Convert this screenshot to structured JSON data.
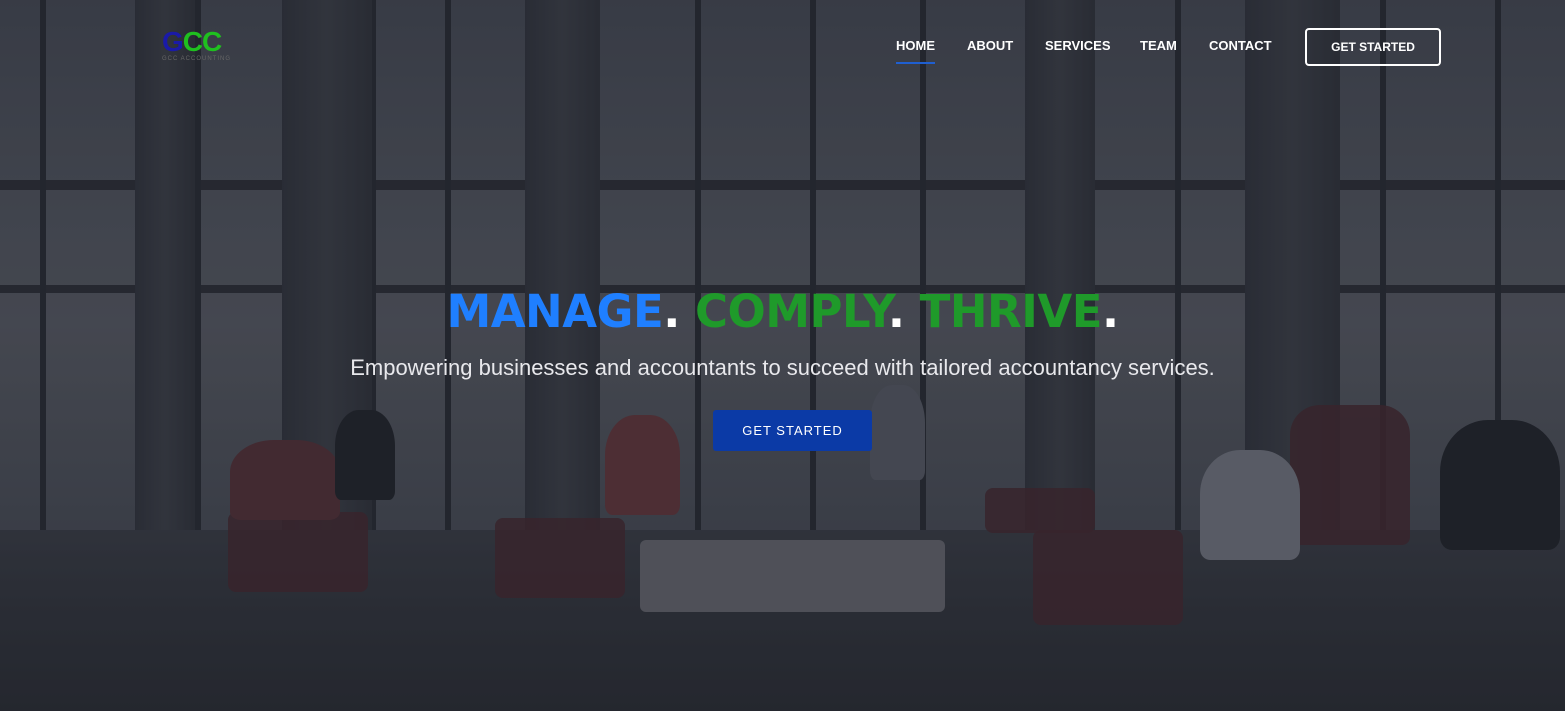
{
  "header": {
    "logo": {
      "mark_first": "G",
      "mark_rest": "CC",
      "tagline": "GCC ACCOUNTING"
    },
    "nav": [
      {
        "label": "HOME",
        "active": true
      },
      {
        "label": "ABOUT",
        "active": false
      },
      {
        "label": "SERVICES",
        "active": false
      },
      {
        "label": "TEAM",
        "active": false
      },
      {
        "label": "CONTACT",
        "active": false
      }
    ],
    "cta_label": "GET STARTED"
  },
  "hero": {
    "headline": {
      "word1": "MANAGE",
      "word2": "COMPLY",
      "word3": "THRIVE",
      "dot": "."
    },
    "subtitle": "Empowering businesses and accountants to succeed with tailored accountancy services.",
    "cta_label": "GET STARTED"
  },
  "colors": {
    "accent_blue": "#1f7fff",
    "accent_green": "#1f9a2a",
    "button_blue": "#0b3aa6",
    "nav_underline": "#1f5fd1"
  }
}
